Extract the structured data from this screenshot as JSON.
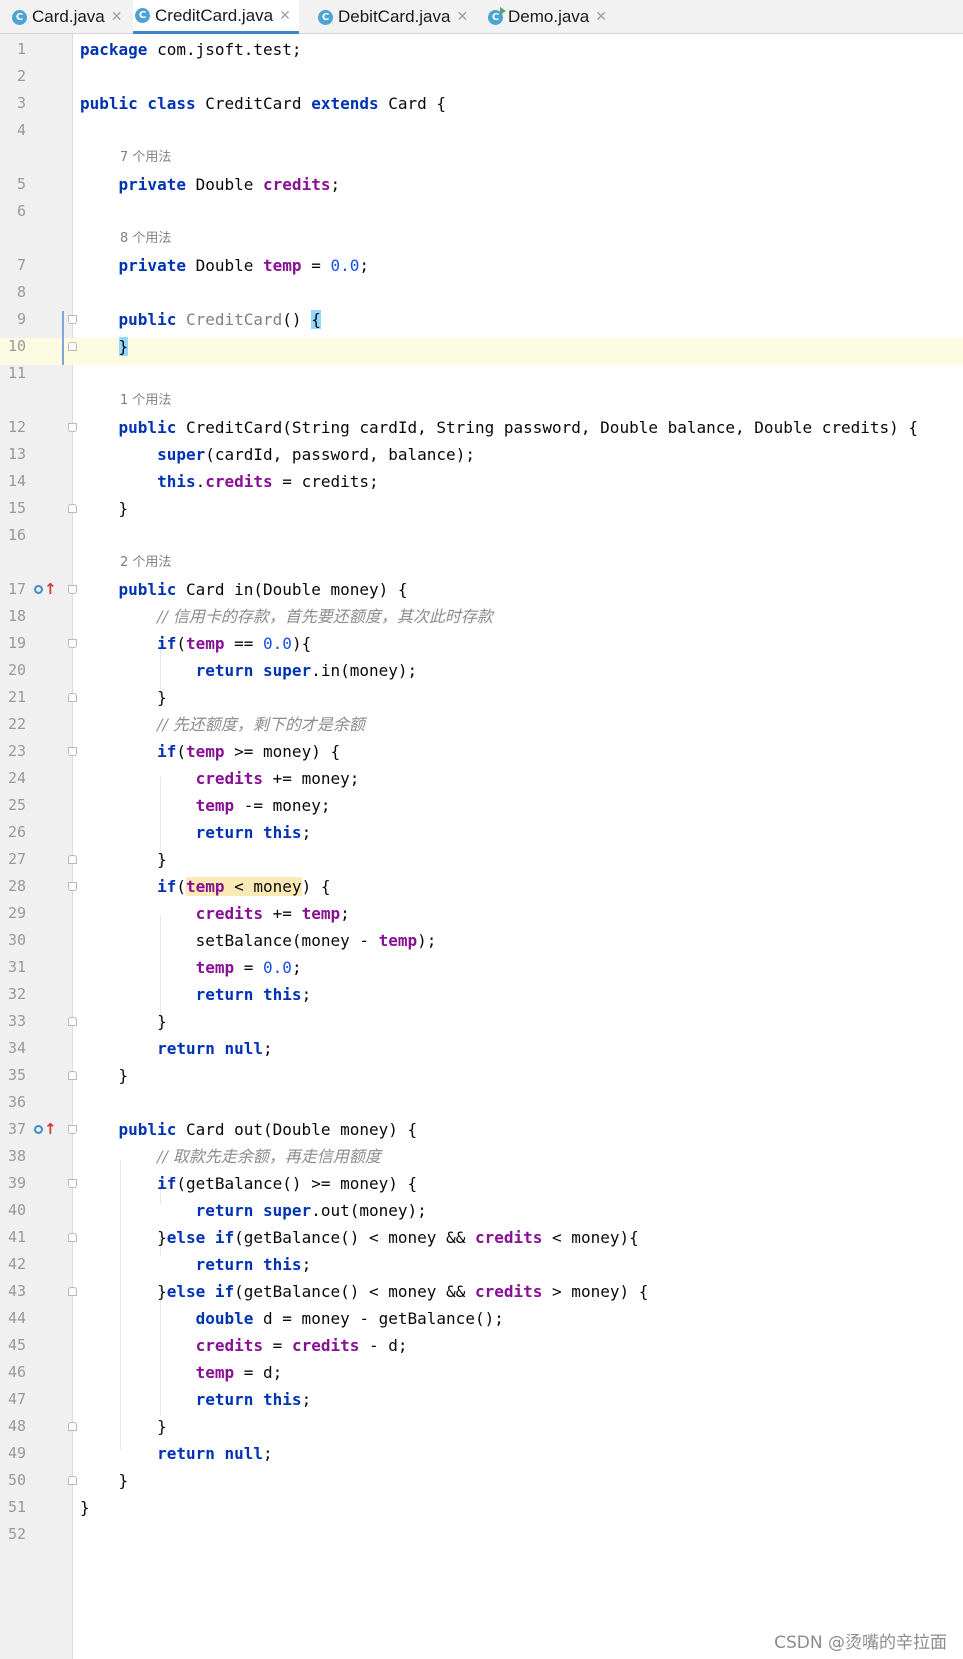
{
  "tabs": [
    {
      "label": "Card.java",
      "active": false,
      "icon": "class-icon"
    },
    {
      "label": "CreditCard.java",
      "active": true,
      "icon": "class-icon"
    },
    {
      "label": "DebitCard.java",
      "active": false,
      "icon": "class-icon"
    },
    {
      "label": "Demo.java",
      "active": false,
      "icon": "runnable-class-icon"
    }
  ],
  "editor": {
    "current_line": 10,
    "hints": {
      "h5": "7 个用法",
      "h7": "8 个用法",
      "h12": "1 个用法",
      "h17": "2 个用法"
    },
    "line_numbers": [
      "1",
      "2",
      "3",
      "4",
      "5",
      "6",
      "7",
      "8",
      "9",
      "10",
      "11",
      "12",
      "13",
      "14",
      "15",
      "16",
      "17",
      "18",
      "19",
      "20",
      "21",
      "22",
      "23",
      "24",
      "25",
      "26",
      "27",
      "28",
      "29",
      "30",
      "31",
      "32",
      "33",
      "34",
      "35",
      "36",
      "37",
      "38",
      "39",
      "40",
      "41",
      "42",
      "43",
      "44",
      "45",
      "46",
      "47",
      "48",
      "49",
      "50",
      "51",
      "52"
    ]
  },
  "watermark": "CSDN @烫嘴的辛拉面",
  "colors": {
    "keyword": "#0033b3",
    "field": "#871094",
    "number": "#1750eb",
    "comment": "#8c8c8c",
    "current_line": "#fdfce2",
    "brace_match": "#93d9ff"
  }
}
